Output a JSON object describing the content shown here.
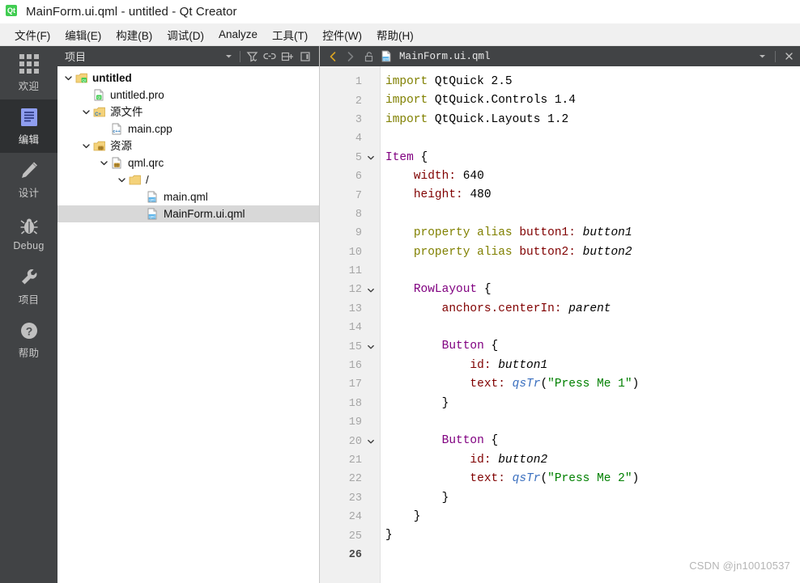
{
  "window": {
    "title": "MainForm.ui.qml - untitled - Qt Creator",
    "app_icon": "qt-logo-icon",
    "app_icon_text": "Qt"
  },
  "menubar": {
    "items": [
      {
        "label": "文件(F)",
        "name": "menu-file"
      },
      {
        "label": "编辑(E)",
        "name": "menu-edit"
      },
      {
        "label": "构建(B)",
        "name": "menu-build"
      },
      {
        "label": "调试(D)",
        "name": "menu-debug"
      },
      {
        "label": "Analyze",
        "name": "menu-analyze"
      },
      {
        "label": "工具(T)",
        "name": "menu-tools"
      },
      {
        "label": "控件(W)",
        "name": "menu-window"
      },
      {
        "label": "帮助(H)",
        "name": "menu-help"
      }
    ]
  },
  "modebar": {
    "items": [
      {
        "label": "欢迎",
        "icon": "grid-icon",
        "selected": false
      },
      {
        "label": "编辑",
        "icon": "document-icon",
        "selected": true
      },
      {
        "label": "设计",
        "icon": "pencil-icon",
        "selected": false
      },
      {
        "label": "Debug",
        "icon": "bug-icon",
        "selected": false
      },
      {
        "label": "项目",
        "icon": "wrench-icon",
        "selected": false
      },
      {
        "label": "帮助",
        "icon": "question-icon",
        "selected": false
      }
    ]
  },
  "sidepanel": {
    "title": "项目",
    "header_icons": [
      {
        "name": "chevron-down-icon"
      },
      {
        "name": "filter-icon"
      },
      {
        "name": "link-icon"
      },
      {
        "name": "split-pane-icon"
      },
      {
        "name": "close-panel-icon"
      }
    ],
    "tree": [
      {
        "label": "untitled",
        "icon": "qt-project-icon",
        "indent": 0,
        "expanded": true,
        "bold": true,
        "selected": false
      },
      {
        "label": "untitled.pro",
        "icon": "pro-file-icon",
        "indent": 1,
        "expanded": null,
        "bold": false,
        "selected": false
      },
      {
        "label": "源文件",
        "icon": "cpp-folder-icon",
        "indent": 1,
        "expanded": true,
        "bold": false,
        "selected": false
      },
      {
        "label": "main.cpp",
        "icon": "cpp-file-icon",
        "indent": 2,
        "expanded": null,
        "bold": false,
        "selected": false
      },
      {
        "label": "资源",
        "icon": "resource-folder-icon",
        "indent": 1,
        "expanded": true,
        "bold": false,
        "selected": false
      },
      {
        "label": "qml.qrc",
        "icon": "qrc-file-icon",
        "indent": 2,
        "expanded": true,
        "bold": false,
        "selected": false
      },
      {
        "label": "/",
        "icon": "folder-icon",
        "indent": 3,
        "expanded": true,
        "bold": false,
        "selected": false
      },
      {
        "label": "main.qml",
        "icon": "qml-file-icon",
        "indent": 4,
        "expanded": null,
        "bold": false,
        "selected": false
      },
      {
        "label": "MainForm.ui.qml",
        "icon": "qml-file-icon",
        "indent": 4,
        "expanded": null,
        "bold": false,
        "selected": true
      }
    ]
  },
  "editor": {
    "toolbar": {
      "back_icon": "back-arrow-icon",
      "forward_icon": "forward-arrow-icon",
      "lock_icon": "unlock-icon",
      "file_icon": "qml-file-icon",
      "filename": "MainForm.ui.qml",
      "dropdown_icon": "chevron-down-icon",
      "close_icon": "close-icon"
    },
    "current_line": 26,
    "lines": [
      {
        "n": 1,
        "fold": false,
        "tokens": [
          {
            "t": "import",
            "c": "k-import"
          },
          {
            "t": " QtQuick 2.5",
            "c": "k-punc"
          }
        ]
      },
      {
        "n": 2,
        "fold": false,
        "tokens": [
          {
            "t": "import",
            "c": "k-import"
          },
          {
            "t": " QtQuick.Controls 1.4",
            "c": "k-punc"
          }
        ]
      },
      {
        "n": 3,
        "fold": false,
        "tokens": [
          {
            "t": "import",
            "c": "k-import"
          },
          {
            "t": " QtQuick.Layouts 1.2",
            "c": "k-punc"
          }
        ]
      },
      {
        "n": 4,
        "fold": false,
        "tokens": []
      },
      {
        "n": 5,
        "fold": true,
        "tokens": [
          {
            "t": "Item",
            "c": "k-type"
          },
          {
            "t": " {",
            "c": "k-punc"
          }
        ]
      },
      {
        "n": 6,
        "fold": false,
        "tokens": [
          {
            "t": "    ",
            "c": "k-punc"
          },
          {
            "t": "width",
            "c": "k-prop"
          },
          {
            "t": ": ",
            "c": "k-prop"
          },
          {
            "t": "640",
            "c": "k-num"
          }
        ]
      },
      {
        "n": 7,
        "fold": false,
        "tokens": [
          {
            "t": "    ",
            "c": "k-punc"
          },
          {
            "t": "height",
            "c": "k-prop"
          },
          {
            "t": ": ",
            "c": "k-prop"
          },
          {
            "t": "480",
            "c": "k-num"
          }
        ]
      },
      {
        "n": 8,
        "fold": false,
        "tokens": []
      },
      {
        "n": 9,
        "fold": false,
        "tokens": [
          {
            "t": "    ",
            "c": "k-punc"
          },
          {
            "t": "property alias",
            "c": "k-import"
          },
          {
            "t": " ",
            "c": "k-punc"
          },
          {
            "t": "button1",
            "c": "k-prop"
          },
          {
            "t": ": ",
            "c": "k-prop"
          },
          {
            "t": "button1",
            "c": "k-val"
          }
        ]
      },
      {
        "n": 10,
        "fold": false,
        "tokens": [
          {
            "t": "    ",
            "c": "k-punc"
          },
          {
            "t": "property alias",
            "c": "k-import"
          },
          {
            "t": " ",
            "c": "k-punc"
          },
          {
            "t": "button2",
            "c": "k-prop"
          },
          {
            "t": ": ",
            "c": "k-prop"
          },
          {
            "t": "button2",
            "c": "k-val"
          }
        ]
      },
      {
        "n": 11,
        "fold": false,
        "tokens": []
      },
      {
        "n": 12,
        "fold": true,
        "tokens": [
          {
            "t": "    ",
            "c": "k-punc"
          },
          {
            "t": "RowLayout",
            "c": "k-type"
          },
          {
            "t": " {",
            "c": "k-punc"
          }
        ]
      },
      {
        "n": 13,
        "fold": false,
        "tokens": [
          {
            "t": "        ",
            "c": "k-punc"
          },
          {
            "t": "anchors.centerIn",
            "c": "k-prop"
          },
          {
            "t": ": ",
            "c": "k-prop"
          },
          {
            "t": "parent",
            "c": "k-val"
          }
        ]
      },
      {
        "n": 14,
        "fold": false,
        "tokens": []
      },
      {
        "n": 15,
        "fold": true,
        "tokens": [
          {
            "t": "        ",
            "c": "k-punc"
          },
          {
            "t": "Button",
            "c": "k-type"
          },
          {
            "t": " {",
            "c": "k-punc"
          }
        ]
      },
      {
        "n": 16,
        "fold": false,
        "tokens": [
          {
            "t": "            ",
            "c": "k-punc"
          },
          {
            "t": "id",
            "c": "k-prop"
          },
          {
            "t": ": ",
            "c": "k-prop"
          },
          {
            "t": "button1",
            "c": "k-val"
          }
        ]
      },
      {
        "n": 17,
        "fold": false,
        "tokens": [
          {
            "t": "            ",
            "c": "k-punc"
          },
          {
            "t": "text",
            "c": "k-prop"
          },
          {
            "t": ": ",
            "c": "k-prop"
          },
          {
            "t": "qsTr",
            "c": "k-func"
          },
          {
            "t": "(",
            "c": "k-punc"
          },
          {
            "t": "\"Press Me 1\"",
            "c": "k-str"
          },
          {
            "t": ")",
            "c": "k-punc"
          }
        ]
      },
      {
        "n": 18,
        "fold": false,
        "tokens": [
          {
            "t": "        }",
            "c": "k-punc"
          }
        ]
      },
      {
        "n": 19,
        "fold": false,
        "tokens": []
      },
      {
        "n": 20,
        "fold": true,
        "tokens": [
          {
            "t": "        ",
            "c": "k-punc"
          },
          {
            "t": "Button",
            "c": "k-type"
          },
          {
            "t": " {",
            "c": "k-punc"
          }
        ]
      },
      {
        "n": 21,
        "fold": false,
        "tokens": [
          {
            "t": "            ",
            "c": "k-punc"
          },
          {
            "t": "id",
            "c": "k-prop"
          },
          {
            "t": ": ",
            "c": "k-prop"
          },
          {
            "t": "button2",
            "c": "k-val"
          }
        ]
      },
      {
        "n": 22,
        "fold": false,
        "tokens": [
          {
            "t": "            ",
            "c": "k-punc"
          },
          {
            "t": "text",
            "c": "k-prop"
          },
          {
            "t": ": ",
            "c": "k-prop"
          },
          {
            "t": "qsTr",
            "c": "k-func"
          },
          {
            "t": "(",
            "c": "k-punc"
          },
          {
            "t": "\"Press Me 2\"",
            "c": "k-str"
          },
          {
            "t": ")",
            "c": "k-punc"
          }
        ]
      },
      {
        "n": 23,
        "fold": false,
        "tokens": [
          {
            "t": "        }",
            "c": "k-punc"
          }
        ]
      },
      {
        "n": 24,
        "fold": false,
        "tokens": [
          {
            "t": "    }",
            "c": "k-punc"
          }
        ]
      },
      {
        "n": 25,
        "fold": false,
        "tokens": [
          {
            "t": "}",
            "c": "k-punc"
          }
        ]
      },
      {
        "n": 26,
        "fold": false,
        "tokens": []
      }
    ]
  },
  "watermark": "CSDN @jn10010537",
  "colors": {
    "modebar_bg": "#414345",
    "modebar_selected_bg": "#2e3032",
    "menubar_bg": "#f0f0f0",
    "gutter_bg": "#f0f0f0",
    "tree_selected_bg": "#d8d8d8",
    "qt_green": "#41cd52",
    "accent_blue": "#8f9ef0"
  }
}
